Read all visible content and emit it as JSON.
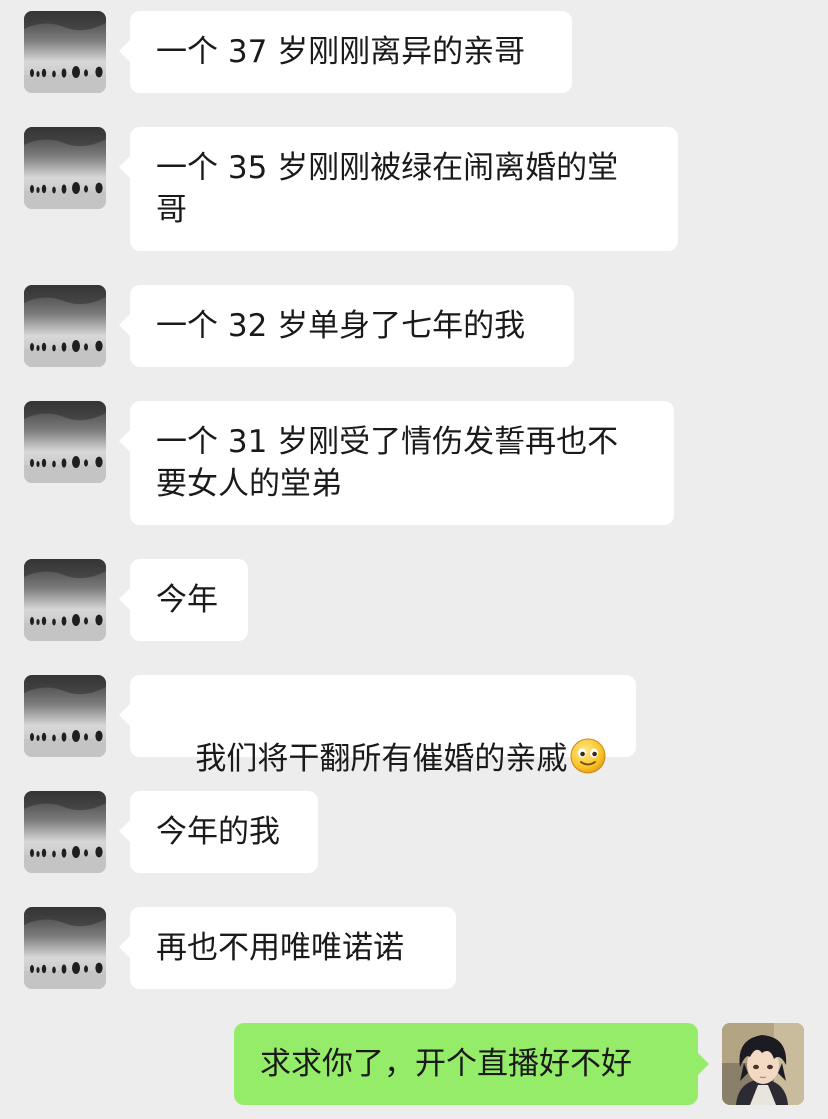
{
  "chat": {
    "messages": [
      {
        "side": "left",
        "text": "一个 37 岁刚刚离异的亲哥",
        "avatar": "landscape-avatar-icon"
      },
      {
        "side": "left",
        "text": "一个 35 岁刚刚被绿在闹离婚的堂\n哥",
        "avatar": "landscape-avatar-icon"
      },
      {
        "side": "left",
        "text": "一个 32 岁单身了七年的我",
        "avatar": "landscape-avatar-icon"
      },
      {
        "side": "left",
        "text": "一个 31 岁刚受了情伤发誓再也不\n要女人的堂弟",
        "avatar": "landscape-avatar-icon"
      },
      {
        "side": "left",
        "text": "今年",
        "avatar": "landscape-avatar-icon"
      },
      {
        "side": "left",
        "text": "我们将干翻所有催婚的亲戚",
        "emoji": "smiley-emoji-icon",
        "avatar": "landscape-avatar-icon"
      },
      {
        "side": "left",
        "text": "今年的我",
        "avatar": "landscape-avatar-icon"
      },
      {
        "side": "left",
        "text": "再也不用唯唯诺诺",
        "avatar": "landscape-avatar-icon"
      },
      {
        "side": "right",
        "text": "求求你了，开个直播好不好",
        "avatar": "anime-avatar-icon"
      }
    ]
  },
  "colors": {
    "background": "#ededed",
    "incoming_bubble": "#ffffff",
    "outgoing_bubble": "#95ec69",
    "text": "#1a1a1a"
  }
}
